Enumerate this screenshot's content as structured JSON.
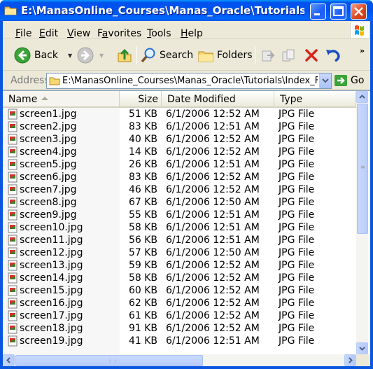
{
  "window": {
    "title": "E:\\ManasOnline_Courses\\Manas_Oracle\\Tutorials\\In..."
  },
  "menubar": {
    "items": [
      {
        "label": "File",
        "accel": "F"
      },
      {
        "label": "Edit",
        "accel": "E"
      },
      {
        "label": "View",
        "accel": "V"
      },
      {
        "label": "Favorites",
        "accel": "a"
      },
      {
        "label": "Tools",
        "accel": "T"
      },
      {
        "label": "Help",
        "accel": "H"
      }
    ]
  },
  "toolbar": {
    "back_label": "Back",
    "search_label": "Search",
    "folders_label": "Folders"
  },
  "addressbar": {
    "label": "Address",
    "value": "E:\\ManasOnline_Courses\\Manas_Oracle\\Tutorials\\Index_File",
    "go_label": "Go"
  },
  "listview": {
    "columns": [
      "Name",
      "Size",
      "Date Modified",
      "Type"
    ],
    "files": [
      {
        "name": "screen1.jpg",
        "size": "51 KB",
        "date": "6/1/2006 12:52 AM",
        "type": "JPG File"
      },
      {
        "name": "screen2.jpg",
        "size": "83 KB",
        "date": "6/1/2006 12:51 AM",
        "type": "JPG File"
      },
      {
        "name": "screen3.jpg",
        "size": "40 KB",
        "date": "6/1/2006 12:52 AM",
        "type": "JPG File"
      },
      {
        "name": "screen4.jpg",
        "size": "14 KB",
        "date": "6/1/2006 12:52 AM",
        "type": "JPG File"
      },
      {
        "name": "screen5.jpg",
        "size": "26 KB",
        "date": "6/1/2006 12:51 AM",
        "type": "JPG File"
      },
      {
        "name": "screen6.jpg",
        "size": "83 KB",
        "date": "6/1/2006 12:52 AM",
        "type": "JPG File"
      },
      {
        "name": "screen7.jpg",
        "size": "46 KB",
        "date": "6/1/2006 12:52 AM",
        "type": "JPG File"
      },
      {
        "name": "screen8.jpg",
        "size": "67 KB",
        "date": "6/1/2006 12:50 AM",
        "type": "JPG File"
      },
      {
        "name": "screen9.jpg",
        "size": "55 KB",
        "date": "6/1/2006 12:51 AM",
        "type": "JPG File"
      },
      {
        "name": "screen10.jpg",
        "size": "58 KB",
        "date": "6/1/2006 12:51 AM",
        "type": "JPG File"
      },
      {
        "name": "screen11.jpg",
        "size": "56 KB",
        "date": "6/1/2006 12:51 AM",
        "type": "JPG File"
      },
      {
        "name": "screen12.jpg",
        "size": "57 KB",
        "date": "6/1/2006 12:50 AM",
        "type": "JPG File"
      },
      {
        "name": "screen13.jpg",
        "size": "59 KB",
        "date": "6/1/2006 12:52 AM",
        "type": "JPG File"
      },
      {
        "name": "screen14.jpg",
        "size": "58 KB",
        "date": "6/1/2006 12:52 AM",
        "type": "JPG File"
      },
      {
        "name": "screen15.jpg",
        "size": "60 KB",
        "date": "6/1/2006 12:52 AM",
        "type": "JPG File"
      },
      {
        "name": "screen16.jpg",
        "size": "62 KB",
        "date": "6/1/2006 12:52 AM",
        "type": "JPG File"
      },
      {
        "name": "screen17.jpg",
        "size": "61 KB",
        "date": "6/1/2006 12:52 AM",
        "type": "JPG File"
      },
      {
        "name": "screen18.jpg",
        "size": "91 KB",
        "date": "6/1/2006 12:52 AM",
        "type": "JPG File"
      },
      {
        "name": "screen19.jpg",
        "size": "41 KB",
        "date": "6/1/2006 12:51 AM",
        "type": "JPG File"
      }
    ],
    "sort_column": "Name",
    "sort_direction": "ascending"
  },
  "colors": {
    "titlebar": "#0053ee",
    "close_button": "#e04a22",
    "window_face": "#ece9d8"
  }
}
